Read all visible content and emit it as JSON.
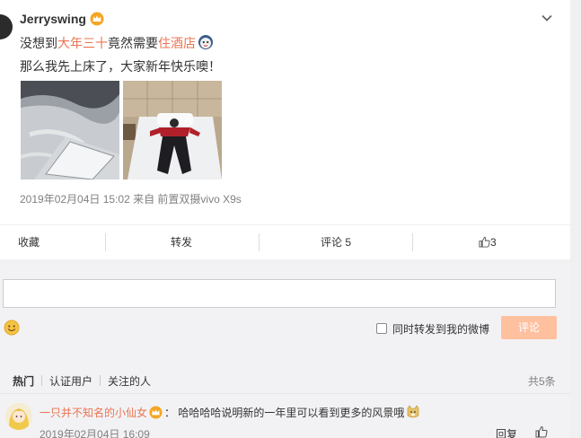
{
  "post": {
    "username": "Jerryswing",
    "text_line1_parts": [
      "没想到",
      "大年三十",
      "竟然需要",
      "住酒店"
    ],
    "text_line2": "那么我先上床了，大家新年快乐噢！",
    "meta": "2019年02月04日 15:02  来自 前置双摄vivo X9s",
    "icons": {
      "verified": "crown-badge-icon",
      "menu": "chevron-down-icon",
      "emoji": "emoji-face-icon"
    }
  },
  "actions": {
    "favorite": "收藏",
    "forward": "转发",
    "comment": "评论 5",
    "like_count": "3"
  },
  "compose": {
    "placeholder": "",
    "forward_label": "同时转发到我的微博",
    "submit_label": "评论"
  },
  "comments": {
    "tabs": [
      "热门",
      "认证用户",
      "关注的人"
    ],
    "total": "共5条",
    "items": [
      {
        "user": "一只并不知名的小仙女",
        "text": "：  哈哈哈哈说明新的一年里可以看到更多的风景哦",
        "time": "2019年02月04日 16:09",
        "reply": "回复"
      }
    ]
  },
  "colors": {
    "accent": "#eb7350",
    "button_disabled": "#ffc09f",
    "link": "#eb7350"
  }
}
